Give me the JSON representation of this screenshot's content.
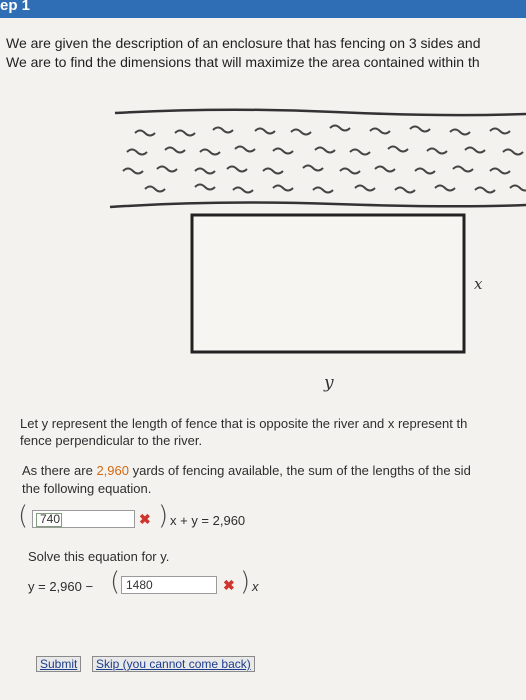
{
  "header": {
    "title": "ep 1"
  },
  "intro": {
    "line1": "We are given the description of an enclosure that has fencing on 3 sides and",
    "line2": "We are to find the dimensions that will maximize the area contained within th"
  },
  "diagram": {
    "x_label": "x",
    "y_label": "y"
  },
  "explanation": {
    "line1": "Let y represent the length of fence that is opposite the river and x represent th",
    "line2": "fence perpendicular to the river."
  },
  "fencing": {
    "line1_prefix": "As there are ",
    "amount": "2,960",
    "line1_suffix": " yards of fencing available, the sum of the lengths of the sid",
    "line2": "the following equation."
  },
  "equation1": {
    "input_value": "740",
    "rest": "x + y = 2,960"
  },
  "solve": {
    "prompt": "Solve this equation for y.",
    "lhs": "y = 2,960 −",
    "input_value": "1480",
    "var": "x"
  },
  "buttons": {
    "submit": "Submit",
    "skip": "Skip (you cannot come back)"
  },
  "colors": {
    "accent": "#2f6db5",
    "highlight": "#d36a12",
    "error": "#d0342c"
  }
}
